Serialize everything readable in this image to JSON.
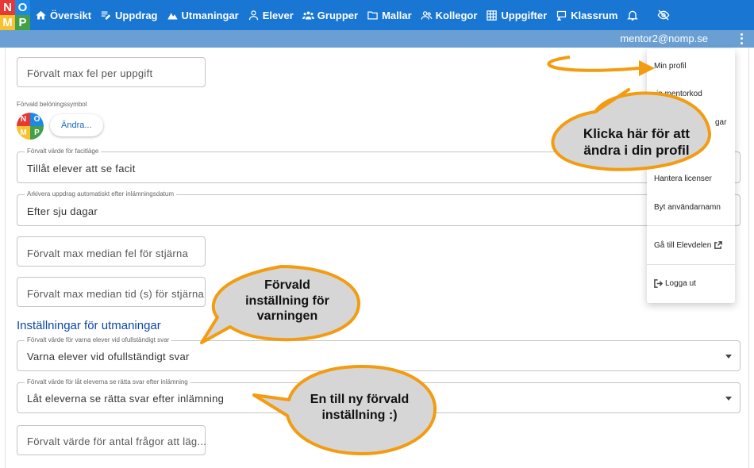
{
  "logo": {
    "letters": [
      "N",
      "O",
      "M",
      "P"
    ]
  },
  "nav": {
    "items": [
      {
        "label": "Översikt",
        "icon": "home-icon"
      },
      {
        "label": "Uppdrag",
        "icon": "edit-note-icon"
      },
      {
        "label": "Utmaningar",
        "icon": "mountain-icon"
      },
      {
        "label": "Elever",
        "icon": "person-icon"
      },
      {
        "label": "Grupper",
        "icon": "group-icon"
      },
      {
        "label": "Mallar",
        "icon": "folder-icon"
      },
      {
        "label": "Kollegor",
        "icon": "people-icon"
      },
      {
        "label": "Uppgifter",
        "icon": "grid-icon"
      },
      {
        "label": "Klassrum",
        "icon": "classroom-icon"
      }
    ],
    "bell_icon": "bell-icon",
    "hide_icon": "eye-off-icon"
  },
  "user": {
    "email": "mentor2@nomp.se"
  },
  "form": {
    "max_errors_placeholder": "Förvalt max fel per uppgift",
    "reward_symbol_label": "Förvald belöningssymbol",
    "change_button": "Ändra...",
    "answer_key_label": "Förvalt värde för facitläge",
    "answer_key_value": "Tillåt elever att se facit",
    "archive_label": "Arkivera uppdrag automatiskt efter inlämningsdatum",
    "archive_value": "Efter sju dagar",
    "median_errors_placeholder": "Förvalt max median fel för stjärna",
    "median_time_placeholder": "Förvalt max median tid (s) för stjärna",
    "challenges_heading": "Inställningar för utmaningar",
    "warn_label": "Förvalt värde för varna elever vid ofullständigt svar",
    "warn_value": "Varna elever vid ofullständigt svar",
    "show_correct_label": "Förvalt värde för låt eleverna se rätta svar efter inlämning",
    "show_correct_value": "Låt eleverna se rätta svar efter inlämning",
    "question_count_placeholder": "Förvalt värde för antal frågor att läg..."
  },
  "menu": {
    "items": [
      {
        "label": "Min profil"
      },
      {
        "label": "in mentorkod"
      },
      {
        "label": "gar"
      },
      {
        "label": "Hantera licenser"
      },
      {
        "label": "Byt användarnamn"
      },
      {
        "label": "Gå till Elevdelen",
        "icon": "external-link-icon"
      },
      {
        "label": "Logga ut",
        "icon": "logout-icon"
      }
    ]
  },
  "callouts": {
    "profile": "Klicka här för att ändra i din profil",
    "warning": "Förvald inställning för varningen",
    "new_default": "En till ny förvald inställning :)"
  },
  "colors": {
    "nav_bg": "#1976d2",
    "subbar_bg": "#6a9fd4",
    "callout_fill": "#d6d6d6",
    "callout_stroke": "#f39c12",
    "accent": "#0d47a1"
  }
}
